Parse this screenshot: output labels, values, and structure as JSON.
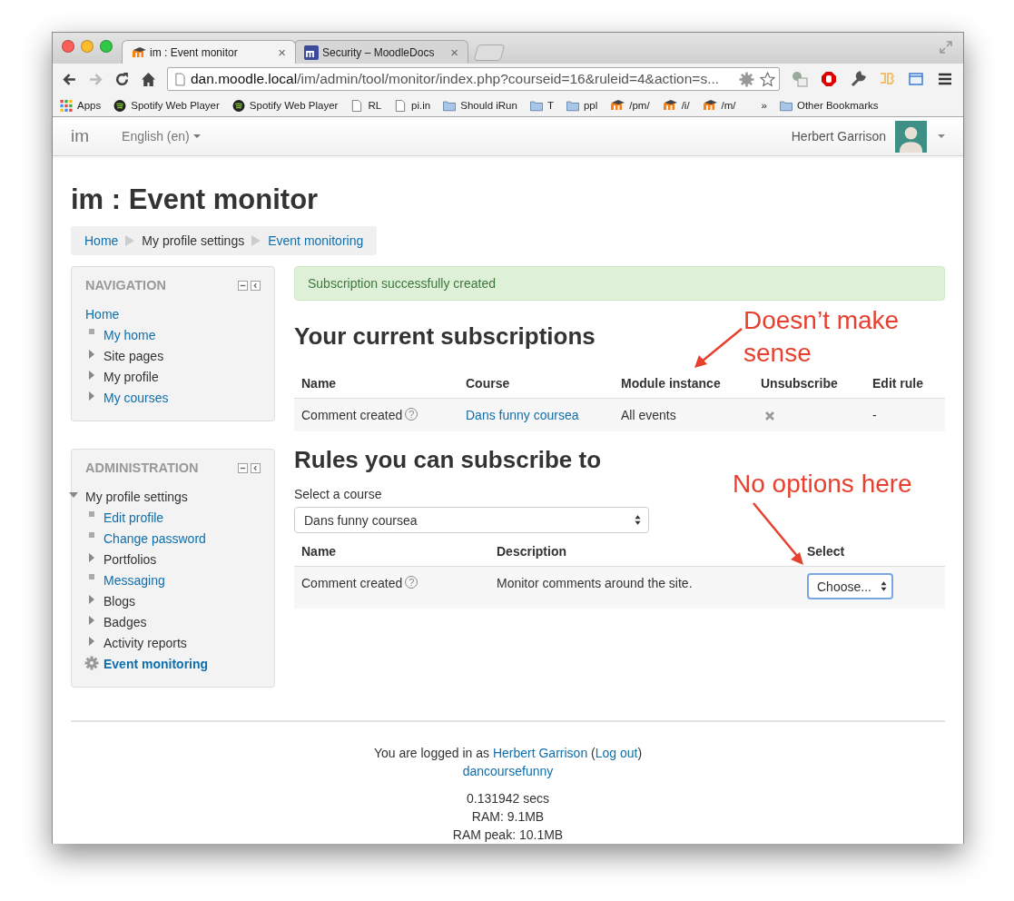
{
  "browser": {
    "tabs": [
      {
        "title": "im : Event monitor",
        "kind": "moodle",
        "selected": true
      },
      {
        "title": "Security – MoodleDocs",
        "kind": "docs",
        "selected": false
      }
    ],
    "address": {
      "host": "dan.moodle.local",
      "path": "/im/admin/tool/monitor/index.php?courseid=16&ruleid=4&action=s..."
    },
    "bookmarks": [
      {
        "label": "Apps",
        "kind": "apps"
      },
      {
        "label": "Spotify Web Player",
        "kind": "spotify"
      },
      {
        "label": "Spotify Web Player",
        "kind": "spotify"
      },
      {
        "label": "RL",
        "kind": "page"
      },
      {
        "label": "pi.in",
        "kind": "page"
      },
      {
        "label": "Should iRun",
        "kind": "folder"
      },
      {
        "label": "T",
        "kind": "folder"
      },
      {
        "label": "ppl",
        "kind": "folder"
      },
      {
        "label": "/pm/",
        "kind": "moodle"
      },
      {
        "label": "/i/",
        "kind": "moodle"
      },
      {
        "label": "/m/",
        "kind": "moodle"
      }
    ],
    "close_glyph": "×",
    "overflow": "»",
    "other_bookmarks": "Other Bookmarks"
  },
  "navbar": {
    "brand": "im",
    "language": "English (en)",
    "user": "Herbert Garrison"
  },
  "page_title": "im : Event monitor",
  "breadcrumb": [
    {
      "label": "Home",
      "link": true
    },
    {
      "label": "My profile settings",
      "link": false
    },
    {
      "label": "Event monitoring",
      "link": true
    }
  ],
  "blocks": [
    {
      "title": "NAVIGATION",
      "items": [
        {
          "label": "Home",
          "kind": "root",
          "link": true,
          "selected": false,
          "children": [
            {
              "label": "My home",
              "kind": "leaf",
              "link": true,
              "selected": false
            },
            {
              "label": "Site pages",
              "kind": "branch",
              "expanded": false,
              "link": false,
              "selected": false
            },
            {
              "label": "My profile",
              "kind": "branch",
              "expanded": false,
              "link": false,
              "selected": false
            },
            {
              "label": "My courses",
              "kind": "branch",
              "expanded": false,
              "link": true,
              "selected": false
            }
          ]
        }
      ]
    },
    {
      "title": "ADMINISTRATION",
      "items": [
        {
          "label": "My profile settings",
          "kind": "branch",
          "expanded": true,
          "link": false,
          "selected": false,
          "children": [
            {
              "label": "Edit profile",
              "kind": "leaf",
              "link": true,
              "selected": false
            },
            {
              "label": "Change password",
              "kind": "leaf",
              "link": true,
              "selected": false
            },
            {
              "label": "Portfolios",
              "kind": "branch",
              "expanded": false,
              "link": false,
              "selected": false
            },
            {
              "label": "Messaging",
              "kind": "leaf",
              "link": true,
              "selected": false
            },
            {
              "label": "Blogs",
              "kind": "branch",
              "expanded": false,
              "link": false,
              "selected": false
            },
            {
              "label": "Badges",
              "kind": "branch",
              "expanded": false,
              "link": false,
              "selected": false
            },
            {
              "label": "Activity reports",
              "kind": "branch",
              "expanded": false,
              "link": false,
              "selected": false
            },
            {
              "label": "Event monitoring",
              "kind": "gear",
              "link": true,
              "selected": true
            }
          ]
        }
      ]
    }
  ],
  "alert": "Subscription successfully created",
  "subscriptions": {
    "heading": "Your current subscriptions",
    "columns": [
      "Name",
      "Course",
      "Module instance",
      "Unsubscribe",
      "Edit rule"
    ],
    "rows": [
      {
        "name": "Comment created",
        "course": "Dans funny coursea",
        "help": "?",
        "instance": "All events",
        "edit": "-"
      }
    ]
  },
  "rules": {
    "heading": "Rules you can subscribe to",
    "select_label": "Select a course",
    "select_value": "Dans funny coursea",
    "columns": [
      "Name",
      "Description",
      "Select"
    ],
    "rows": [
      {
        "name": "Comment created",
        "help": "?",
        "description": "Monitor comments around the site.",
        "choose": "Choose..."
      }
    ]
  },
  "annotations": [
    "Doesn’t make sense",
    "No options here"
  ],
  "footer": {
    "login": [
      {
        "text": "You are logged in as ",
        "link": false
      },
      {
        "text": "Herbert Garrison",
        "link": true
      },
      {
        "text": " (",
        "link": false
      },
      {
        "text": "Log out",
        "link": true
      },
      {
        "text": ")",
        "link": false
      }
    ],
    "course_link": "dancoursefunny",
    "stats": [
      "0.131942 secs",
      "RAM: 9.1MB",
      "RAM peak: 10.1MB"
    ]
  }
}
